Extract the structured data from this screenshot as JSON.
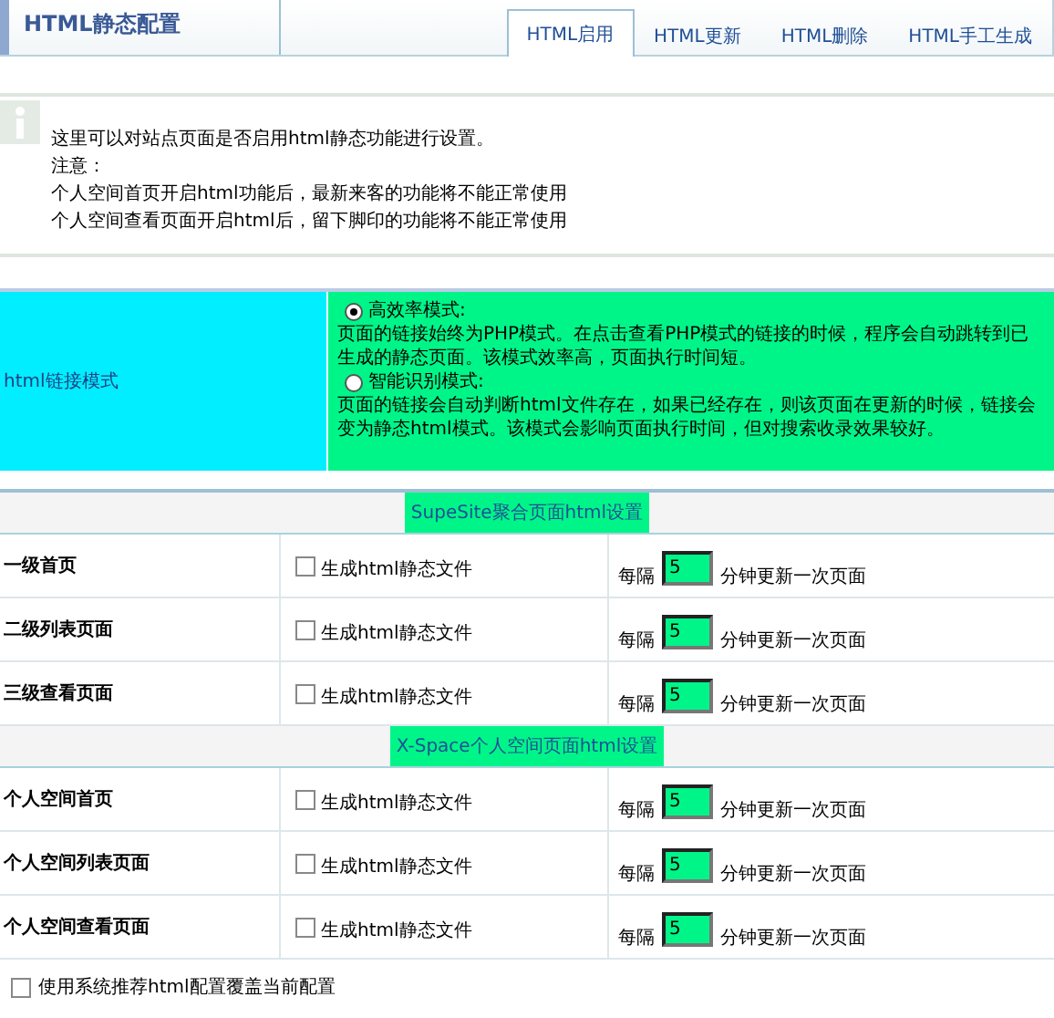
{
  "header": {
    "title": "HTML静态配置"
  },
  "tabs": [
    {
      "label": "HTML启用",
      "selected": true
    },
    {
      "label": "HTML更新",
      "selected": false
    },
    {
      "label": "HTML删除",
      "selected": false
    },
    {
      "label": "HTML手工生成",
      "selected": false
    }
  ],
  "info": {
    "lines": [
      "这里可以对站点页面是否启用html静态功能进行设置。",
      "注意：",
      "个人空间首页开启html功能后，最新来客的功能将不能正常使用",
      "个人空间查看页面开启html后，留下脚印的功能将不能正常使用"
    ]
  },
  "link_mode": {
    "label": "html链接模式",
    "options": [
      {
        "title": "高效率模式:",
        "description": "页面的链接始终为PHP模式。在点击查看PHP模式的链接的时候，程序会自动跳转到已生成的静态页面。该模式效率高，页面执行时间短。",
        "selected": true
      },
      {
        "title": "智能识别模式:",
        "description": "页面的链接会自动判断html文件存在，如果已经存在，则该页面在更新的时候，链接会变为静态html模式。该模式会影响页面执行时间，但对搜索收录效果较好。",
        "selected": false
      }
    ]
  },
  "sections": [
    {
      "title": "SupeSite聚合页面html设置",
      "rows": [
        {
          "name": "一级首页",
          "checkbox_label": "生成html静态文件",
          "checked": false,
          "prefix": "每隔",
          "interval": "5",
          "suffix": "分钟更新一次页面"
        },
        {
          "name": "二级列表页面",
          "checkbox_label": "生成html静态文件",
          "checked": false,
          "prefix": "每隔",
          "interval": "5",
          "suffix": "分钟更新一次页面"
        },
        {
          "name": "三级查看页面",
          "checkbox_label": "生成html静态文件",
          "checked": false,
          "prefix": "每隔",
          "interval": "5",
          "suffix": "分钟更新一次页面"
        }
      ]
    },
    {
      "title": "X-Space个人空间页面html设置",
      "rows": [
        {
          "name": "个人空间首页",
          "checkbox_label": "生成html静态文件",
          "checked": false,
          "prefix": "每隔",
          "interval": "5",
          "suffix": "分钟更新一次页面"
        },
        {
          "name": "个人空间列表页面",
          "checkbox_label": "生成html静态文件",
          "checked": false,
          "prefix": "每隔",
          "interval": "5",
          "suffix": "分钟更新一次页面"
        },
        {
          "name": "个人空间查看页面",
          "checkbox_label": "生成html静态文件",
          "checked": false,
          "prefix": "每隔",
          "interval": "5",
          "suffix": "分钟更新一次页面"
        }
      ]
    }
  ],
  "footer": {
    "label": "使用系统推荐html配置覆盖当前配置",
    "checked": false
  }
}
